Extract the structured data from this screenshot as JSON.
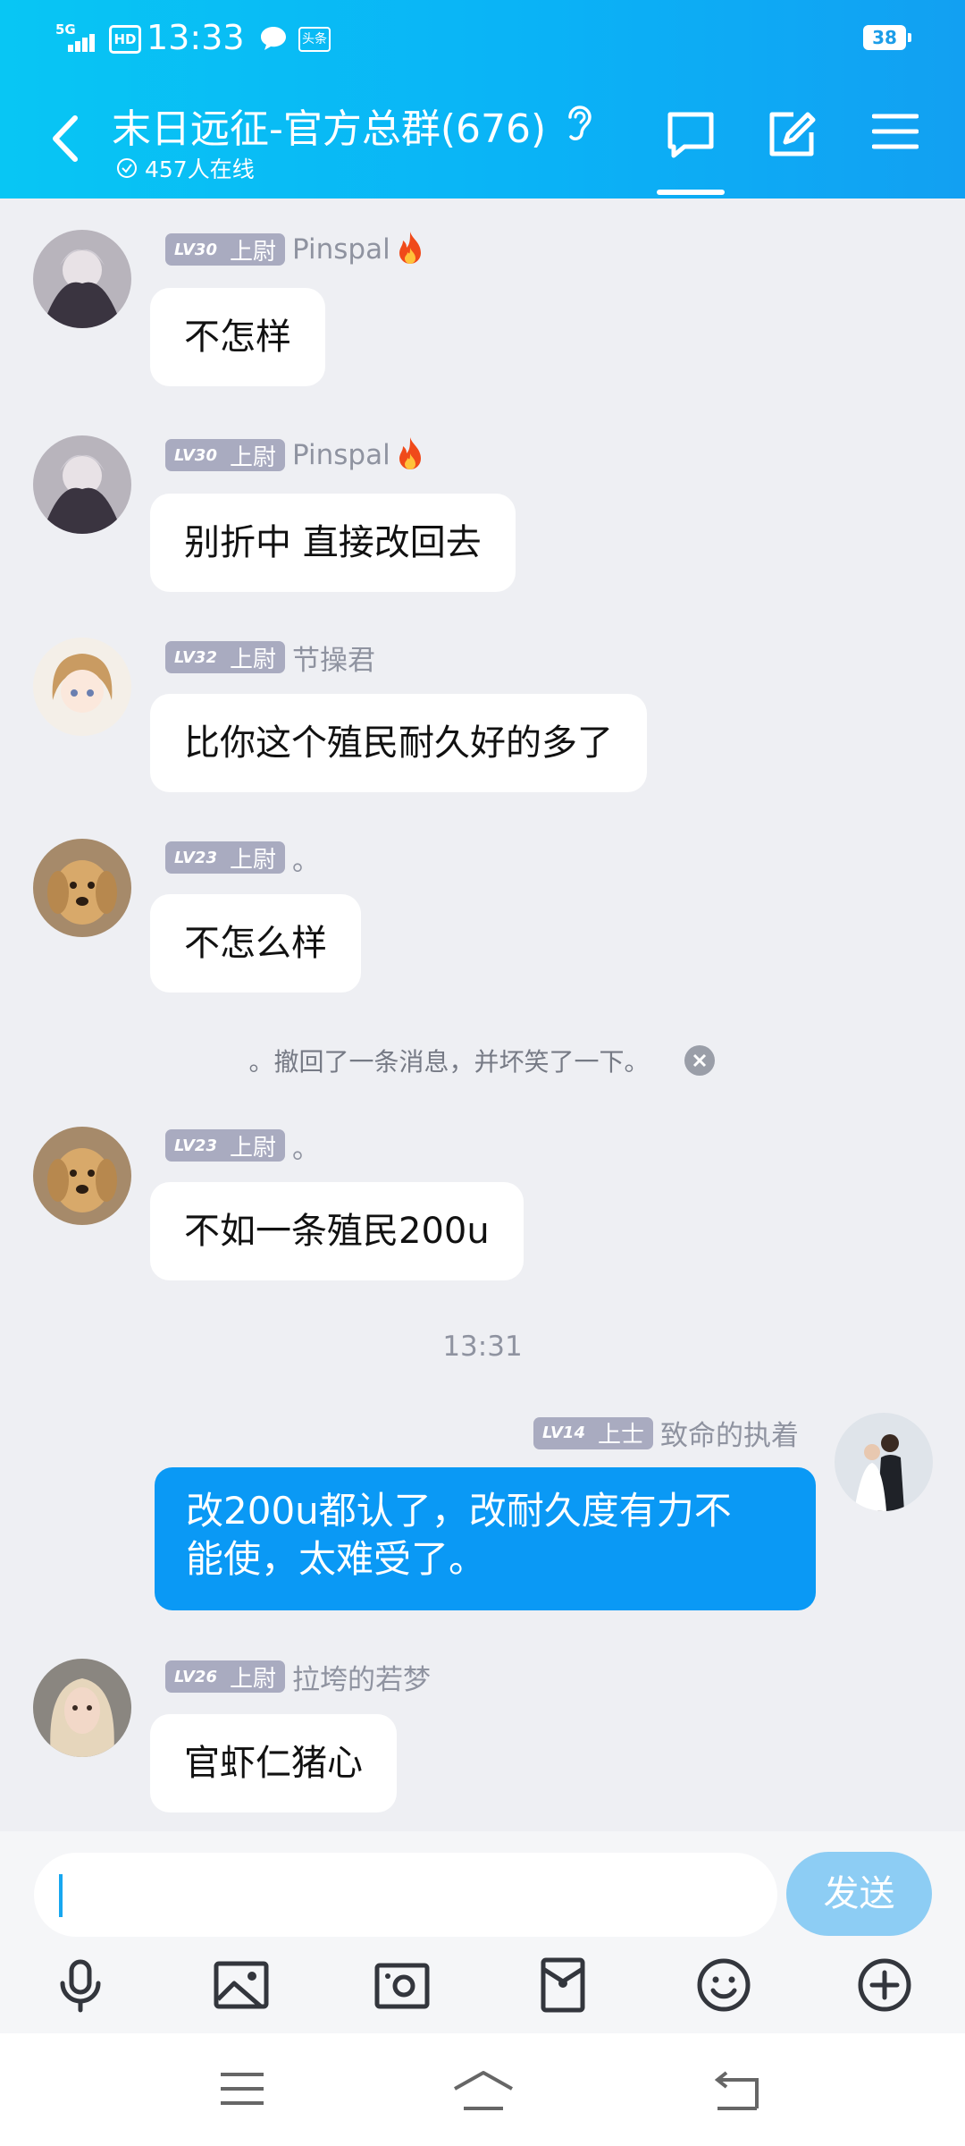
{
  "status_bar": {
    "network": "5G",
    "hd": "HD",
    "time": "13:33",
    "news_label": "头条",
    "battery": "38"
  },
  "header": {
    "title": "末日远征-官方总群(676)",
    "online_count": "457人在线"
  },
  "messages": [
    {
      "lv": "LV30",
      "rank": "上尉",
      "name": "Pinspal",
      "text": "不怎样"
    },
    {
      "lv": "LV30",
      "rank": "上尉",
      "name": "Pinspal",
      "text": "别折中 直接改回去"
    },
    {
      "lv": "LV32",
      "rank": "上尉",
      "name": "节操君",
      "text": "比你这个殖民耐久好的多了"
    },
    {
      "lv": "LV23",
      "rank": "上尉",
      "name": "。",
      "text": "不怎么样"
    },
    {
      "lv": "LV23",
      "rank": "上尉",
      "name": "。",
      "text": "不如一条殖民200u"
    },
    {
      "lv": "LV26",
      "rank": "上尉",
      "name": "拉垮的若梦",
      "text": "官虾仁猪心"
    }
  ],
  "system_notice": "。撤回了一条消息，并坏笑了一下。",
  "timestamp": "13:31",
  "my_message": {
    "lv": "LV14",
    "rank": "上士",
    "name": "致命的执着",
    "line1": "改200u都认了，改耐久度有力不",
    "line2": "能使，太难受了。"
  },
  "input": {
    "value": "",
    "send_label": "发送"
  },
  "colors": {
    "header": "#0ab3f6",
    "my_bubble": "#0a99f5",
    "badge": "#a9abc0",
    "send": "#8dcdf4"
  },
  "icons": [
    "back-icon",
    "ear-icon",
    "chat-icon",
    "edit-icon",
    "menu-icon",
    "mic-icon",
    "image-icon",
    "camera-icon",
    "red-packet-icon",
    "emoji-icon",
    "plus-icon",
    "nav-menu-icon",
    "nav-home-icon",
    "nav-back-icon"
  ]
}
